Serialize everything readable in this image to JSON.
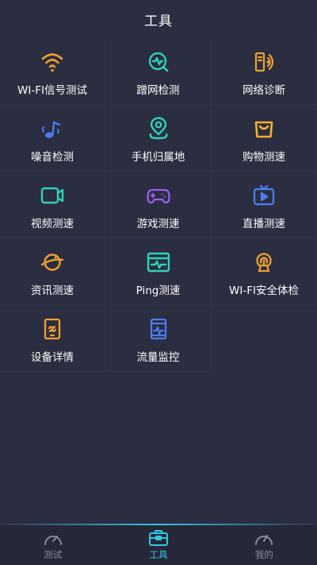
{
  "header": {
    "title": "工具"
  },
  "tools": [
    {
      "label": "WI-FI信号测试",
      "icon": "wifi-icon",
      "color": "#f0a030"
    },
    {
      "label": "蹭网检测",
      "icon": "network-search-icon",
      "color": "#2fd2b8"
    },
    {
      "label": "网络诊断",
      "icon": "diagnosis-icon",
      "color": "#f0a030"
    },
    {
      "label": "噪音检测",
      "icon": "noise-icon",
      "color": "#4a7cf0"
    },
    {
      "label": "手机归属地",
      "icon": "location-pin-icon",
      "color": "#2fd2b8"
    },
    {
      "label": "购物测速",
      "icon": "shopping-bag-icon",
      "color": "#f0b030"
    },
    {
      "label": "视频测速",
      "icon": "video-camera-icon",
      "color": "#2fd2b8"
    },
    {
      "label": "游戏测速",
      "icon": "gamepad-icon",
      "color": "#9b5cf0"
    },
    {
      "label": "直播测速",
      "icon": "live-tv-icon",
      "color": "#4a7cf0"
    },
    {
      "label": "资讯测速",
      "icon": "news-planet-icon",
      "color": "#f0a030"
    },
    {
      "label": "Ping测速",
      "icon": "ping-monitor-icon",
      "color": "#2fd2b8"
    },
    {
      "label": "WI-FI安全体检",
      "icon": "wifi-security-icon",
      "color": "#f0a030"
    },
    {
      "label": "设备详情",
      "icon": "device-info-icon",
      "color": "#f0a030"
    },
    {
      "label": "流量监控",
      "icon": "traffic-monitor-icon",
      "color": "#4a7cf0"
    }
  ],
  "tabbar": {
    "tabs": [
      {
        "label": "测试",
        "icon": "speedometer-icon",
        "active": false
      },
      {
        "label": "工具",
        "icon": "toolbox-icon",
        "active": true
      },
      {
        "label": "我的",
        "icon": "profile-gauge-icon",
        "active": false
      }
    ],
    "accent_color": "#34c6e6",
    "inactive_color": "#8a8c9a"
  }
}
